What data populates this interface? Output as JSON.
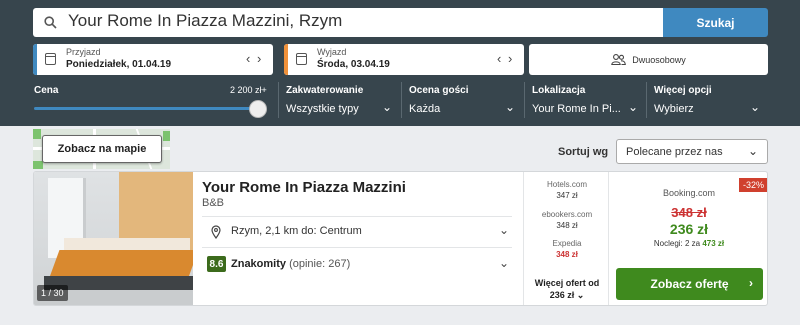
{
  "search": {
    "query": "Your Rome In Piazza Mazzini, Rzym",
    "button": "Szukaj"
  },
  "dates": {
    "checkin": {
      "label": "Przyjazd",
      "value": "Poniedziałek, 01.04.19",
      "color": "#3f89c0"
    },
    "checkout": {
      "label": "Wyjazd",
      "value": "Środa, 03.04.19",
      "color": "#f0913a"
    }
  },
  "guests": {
    "label": "Dwuosobowy"
  },
  "filters": {
    "price": {
      "label": "Cena",
      "max": "2 200 zł+",
      "level": 1.0
    },
    "accommodation": {
      "label": "Zakwaterowanie",
      "value": "Wszystkie typy"
    },
    "rating": {
      "label": "Ocena gości",
      "value": "Każda"
    },
    "location": {
      "label": "Lokalizacja",
      "value": "Your Rome In Pi..."
    },
    "more": {
      "label": "Więcej opcji",
      "value": "Wybierz"
    }
  },
  "map": {
    "button": "Zobacz na mapie"
  },
  "sort": {
    "label": "Sortuj wg",
    "value": "Polecane przez nas"
  },
  "hotel": {
    "name": "Your Rome In Piazza Mazzini",
    "type": "B&B",
    "location": "Rzym, 2,1 km do: Centrum",
    "score": "8.6",
    "rating_word": "Znakomity",
    "reviews": "(opinie: 267)",
    "photo_count": "1 / 30"
  },
  "comparison": {
    "sites": [
      {
        "name": "Hotels.com",
        "price": "347 zł",
        "highlight": false
      },
      {
        "name": "ebookers.com",
        "price": "348 zł",
        "highlight": false
      },
      {
        "name": "Expedia",
        "price": "348 zł",
        "highlight": true
      }
    ],
    "more_line1": "Więcej ofert od",
    "more_line2": "236 zł"
  },
  "deal": {
    "discount": "-32%",
    "site": "Booking.com",
    "old_price": "348 zł",
    "new_price": "236 zł",
    "nights_prefix": "Noclegi: 2 za ",
    "nights_total": "473 zł",
    "button": "Zobacz ofertę"
  },
  "icons": {
    "search": "search-icon",
    "calendar": "calendar-icon",
    "guests": "users-icon",
    "location": "map-pin-icon",
    "chevron": "chevron-down-icon",
    "arrow": "chevron-right-icon"
  }
}
